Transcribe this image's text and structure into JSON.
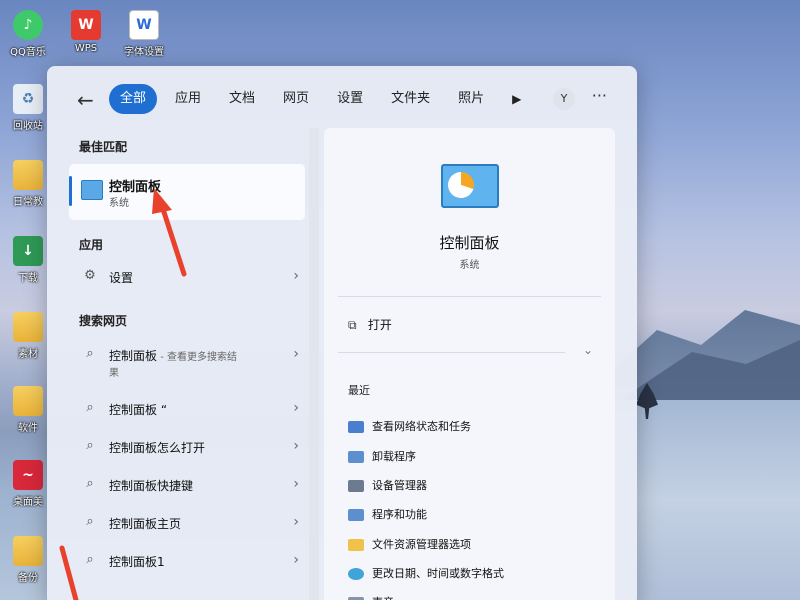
{
  "desktop": {
    "icons": [
      {
        "label": "QQ音乐",
        "icon": "qq-music-icon"
      },
      {
        "label": "WPS",
        "icon": "wps-icon"
      },
      {
        "label": "字体设置",
        "icon": "word-doc-icon"
      },
      {
        "label": "回收站",
        "icon": "recycle-bin-icon"
      },
      {
        "label": "日常教",
        "icon": "folder-icon"
      },
      {
        "label": "下载",
        "icon": "download-folder-icon"
      },
      {
        "label": "素材",
        "icon": "folder-icon"
      },
      {
        "label": "软件",
        "icon": "folder-icon"
      },
      {
        "label": "桌面美",
        "icon": "app-icon"
      },
      {
        "label": "备份",
        "icon": "folder-icon"
      }
    ]
  },
  "search": {
    "tabs": [
      "全部",
      "应用",
      "文档",
      "网页",
      "设置",
      "文件夹",
      "照片"
    ],
    "active_tab": "全部",
    "avatar": "Y",
    "more": "···",
    "best_match_title": "最佳匹配",
    "best_match": {
      "name": "控制面板",
      "category": "系统"
    },
    "apps_title": "应用",
    "apps": [
      {
        "label": "设置"
      }
    ],
    "web_title": "搜索网页",
    "web_results": [
      {
        "text": "控制面板",
        "suffix": " - 查看更多搜索结",
        "suffix2": "果"
      },
      {
        "text": "控制面板 “",
        "suffix": ""
      },
      {
        "text": "控制面板怎么打开",
        "suffix": ""
      },
      {
        "text": "控制面板快捷键",
        "suffix": ""
      },
      {
        "text": "控制面板主页",
        "suffix": ""
      },
      {
        "text": "控制面板1",
        "suffix": ""
      }
    ],
    "preview": {
      "name": "控制面板",
      "category": "系统",
      "open_label": "打开",
      "recent_title": "最近",
      "recent": [
        "查看网络状态和任务",
        "卸载程序",
        "设备管理器",
        "程序和功能",
        "文件资源管理器选项",
        "更改日期、时间或数字格式",
        "声音"
      ]
    }
  },
  "colors": {
    "accent": "#1f6fd2",
    "annotation": "#e8412c"
  }
}
